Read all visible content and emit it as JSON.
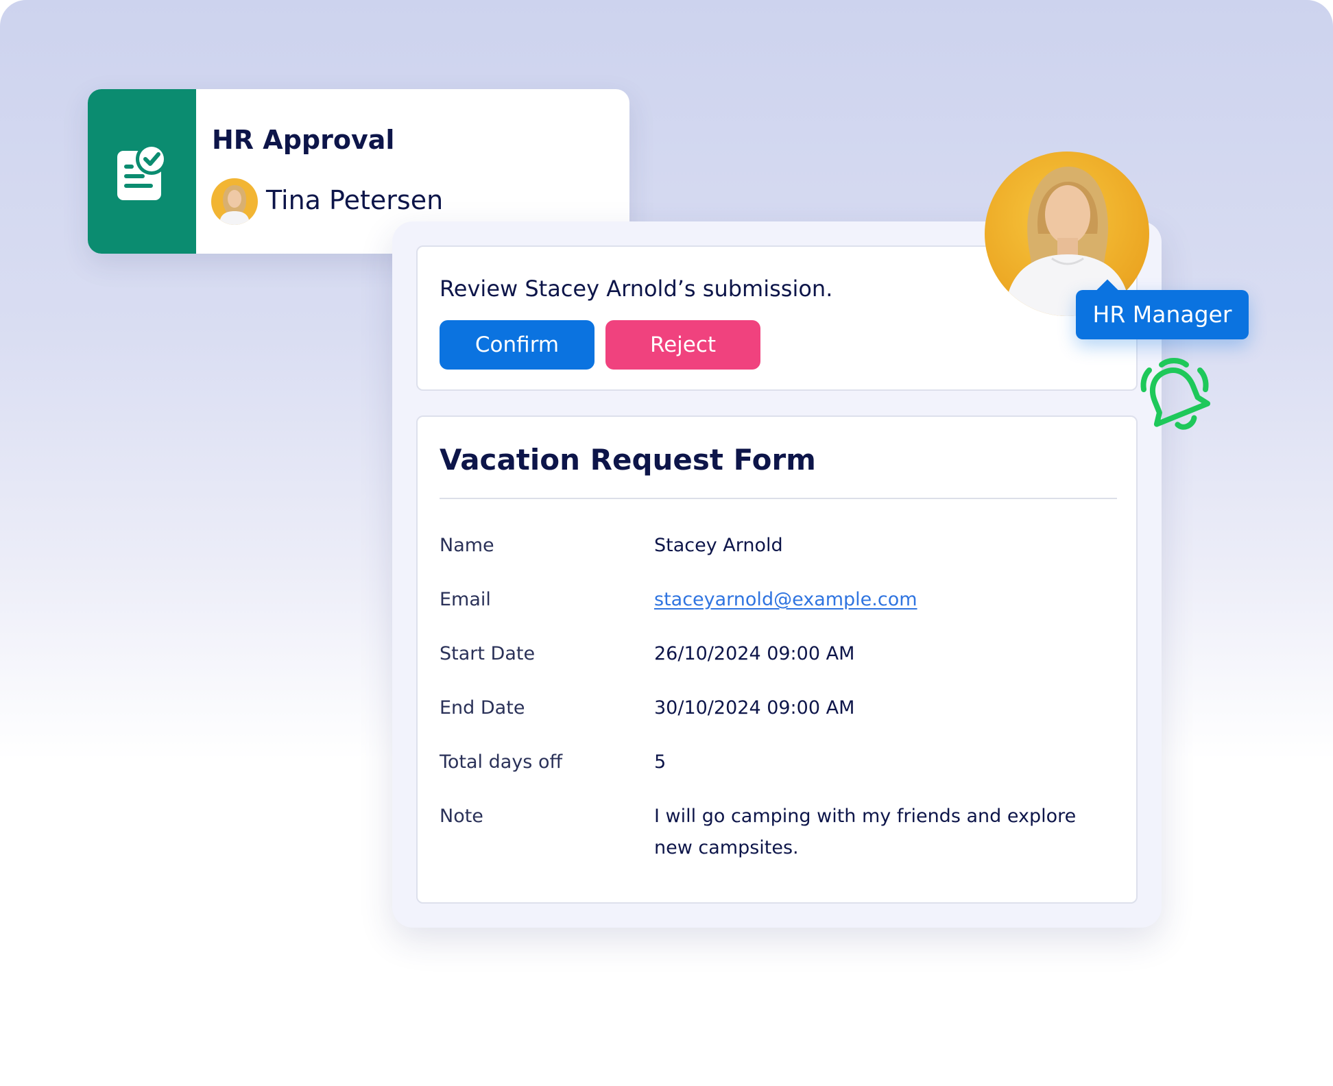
{
  "approval_card": {
    "title": "HR Approval",
    "approver_name": "Tina Petersen",
    "icon": "document-check-icon"
  },
  "review": {
    "prompt": "Review Stacey Arnold’s submission.",
    "confirm_label": "Confirm",
    "reject_label": "Reject"
  },
  "form": {
    "title": "Vacation Request Form",
    "fields": [
      {
        "label": "Name",
        "value": "Stacey Arnold"
      },
      {
        "label": "Email",
        "value": "staceyarnold@example.com"
      },
      {
        "label": "Start Date",
        "value": "26/10/2024 09:00 AM"
      },
      {
        "label": "End Date",
        "value": "30/10/2024 09:00 AM"
      },
      {
        "label": "Total days off",
        "value": "5"
      },
      {
        "label": "Note",
        "value": "I will go camping with my friends and explore new campsites."
      }
    ]
  },
  "manager": {
    "role_label": "HR Manager",
    "notification_icon": "bell-icon"
  },
  "colors": {
    "brand_green": "#0b8c70",
    "primary_blue": "#0b73e0",
    "reject_pink": "#f0427e",
    "text_dark": "#0d1549",
    "link_blue": "#2f74e0",
    "bell_green": "#1ec85a"
  }
}
